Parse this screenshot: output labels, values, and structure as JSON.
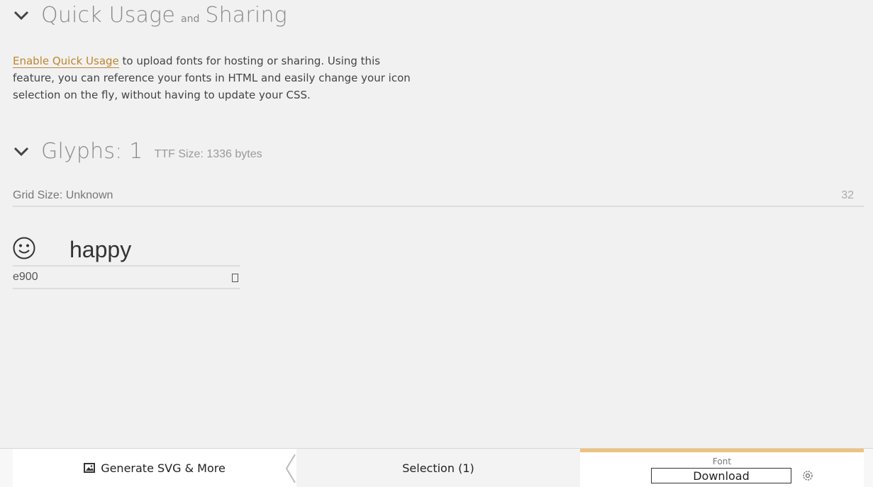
{
  "quick_usage": {
    "title_part1": "Quick Usage",
    "title_and": "and",
    "title_part2": "Sharing",
    "link_text": "Enable Quick Usage",
    "description": " to upload fonts for hosting or sharing. Using this feature, you can reference your fonts in HTML and easily change your icon selection on the fly, without having to update your CSS."
  },
  "glyphs": {
    "title": "Glyphs: 1",
    "ttf_size": "TTF Size: 1336 bytes",
    "grid_label": "Grid Size: Unknown",
    "grid_value": "32",
    "items": [
      {
        "icon": "smiley-icon",
        "name": "happy",
        "code": "e900"
      }
    ]
  },
  "bottom_bar": {
    "generate_label": "Generate SVG & More",
    "selection_label": "Selection (1)",
    "font_label": "Font",
    "download_label": "Download"
  },
  "colors": {
    "accent": "#c0862f",
    "tab_highlight": "#efc27e",
    "background": "#f1f1f1"
  }
}
